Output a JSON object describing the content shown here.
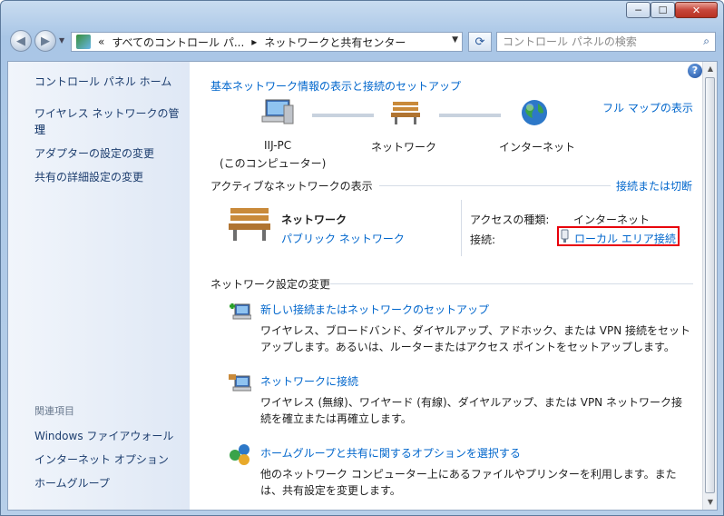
{
  "window": {
    "min_label": "─",
    "max_label": "☐",
    "close_label": "✕"
  },
  "address": {
    "prefix": "«",
    "crumbs": [
      "すべてのコントロール パ...",
      "ネットワークと共有センター"
    ],
    "separator": "▸"
  },
  "search": {
    "placeholder": "コントロール パネルの検索"
  },
  "sidebar": {
    "items": [
      "コントロール パネル ホーム",
      "ワイヤレス ネットワークの管理",
      "理",
      "アダプターの設定の変更",
      "共有の詳細設定の変更"
    ],
    "related_title": "関連項目",
    "related": [
      "Windows ファイアウォール",
      "インターネット オプション",
      "ホームグループ"
    ]
  },
  "main": {
    "header_link": "基本ネットワーク情報の表示と接続のセットアップ",
    "full_map": "フル マップの表示",
    "map": {
      "computer_name": "IIJ-PC",
      "computer_sub": "(このコンピューター)",
      "network": "ネットワーク",
      "internet": "インターネット"
    },
    "active_title": "アクティブなネットワークの表示",
    "connect_disconnect": "接続または切断",
    "network_name": "ネットワーク",
    "network_type": "パブリック ネットワーク",
    "access_label": "アクセスの種類:",
    "access_value": "インターネット",
    "connection_label": "接続:",
    "connection_value": "ローカル エリア接続",
    "change_title": "ネットワーク設定の変更",
    "tasks": [
      {
        "title": "新しい接続またはネットワークのセットアップ",
        "desc1": "ワイヤレス、ブロードバンド、ダイヤルアップ、アドホック、または VPN 接続をセット",
        "desc2": "アップします。あるいは、ルーターまたはアクセス ポイントをセットアップします。"
      },
      {
        "title": "ネットワークに接続",
        "desc1": "ワイヤレス (無線)、ワイヤード (有線)、ダイヤルアップ、または VPN ネットワーク接",
        "desc2": "続を確立または再確立します。"
      },
      {
        "title": "ホームグループと共有に関するオプションを選択する",
        "desc1": "他のネットワーク コンピューター上にあるファイルやプリンターを利用します。また",
        "desc2": "は、共有設定を変更します。"
      }
    ]
  },
  "help_label": "?",
  "colors": {
    "link": "#0066cc",
    "highlight": "#e8000b",
    "sidebar_text": "#1c3d6e"
  }
}
